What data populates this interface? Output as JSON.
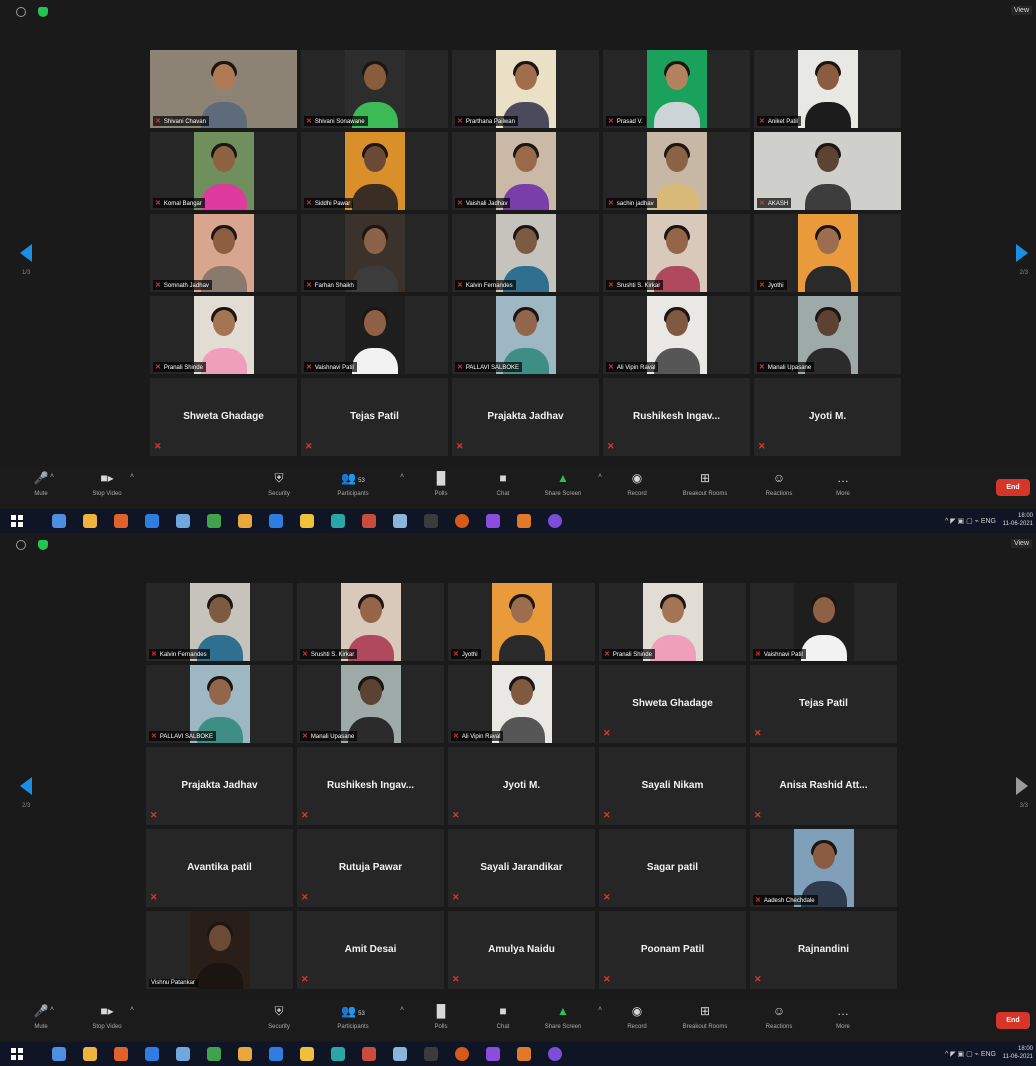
{
  "screenshots": [
    {
      "top_bar": {
        "view_label": "View"
      },
      "nav": {
        "left_page": "1/3",
        "right_page": "2/3"
      },
      "participants": [
        {
          "name": "Shivani Chavan",
          "video": true,
          "wide": true,
          "skin": "#b07a56",
          "shirt": "#5e6b7a",
          "bg": "#8d8374"
        },
        {
          "name": "Shivani Sonawane",
          "video": true,
          "skin": "#8a5c3e",
          "shirt": "#3cba55",
          "bg": "#2d2d2d"
        },
        {
          "name": "Prarthana Pailwan",
          "video": true,
          "skin": "#a26d4c",
          "shirt": "#4a4a5c",
          "bg": "#e9e0c6"
        },
        {
          "name": "Prasad V.",
          "video": true,
          "skin": "#b3835f",
          "shirt": "#cdd4d8",
          "bg": "#1aa25d"
        },
        {
          "name": "Aniket Patil",
          "video": true,
          "skin": "#8b5d40",
          "shirt": "#1c1c1c",
          "bg": "#e8e8e4"
        },
        {
          "name": "Komal Bangar",
          "video": true,
          "skin": "#8f6244",
          "shirt": "#de3aa0",
          "bg": "#6f8f5c"
        },
        {
          "name": "Siddhi Pawar",
          "video": true,
          "skin": "#6a4a35",
          "shirt": "#3a2d24",
          "bg": "#d9902a"
        },
        {
          "name": "Vaishali Jadhav",
          "video": true,
          "skin": "#9a6a4b",
          "shirt": "#7a3ea8",
          "bg": "#c9b9a6"
        },
        {
          "name": "sachin jadhav",
          "video": true,
          "skin": "#8b6345",
          "shirt": "#d8b978",
          "bg": "#c7b8a6"
        },
        {
          "name": "AKASH",
          "video": true,
          "wide": true,
          "skin": "#5b4434",
          "shirt": "#3d3d3d",
          "bg": "#cfcfcc"
        },
        {
          "name": "Somnath Jadhav",
          "video": true,
          "skin": "#8d5e42",
          "shirt": "#8a7a6e",
          "bg": "#d8a58e"
        },
        {
          "name": "Farhan Shaikh",
          "video": true,
          "skin": "#8a6349",
          "shirt": "#3c3c3c",
          "bg": "#3b322b"
        },
        {
          "name": "Kalvin Fernandes",
          "video": true,
          "skin": "#7d5a42",
          "shirt": "#2f6f8f",
          "bg": "#c6c3bd"
        },
        {
          "name": "Srushti S. Kirkar",
          "video": true,
          "skin": "#946548",
          "shirt": "#b0485e",
          "bg": "#d9c9bb"
        },
        {
          "name": "Jyothi",
          "video": true,
          "skin": "#9c6d4e",
          "shirt": "#2a2a2a",
          "bg": "#e99a3a"
        },
        {
          "name": "Pranali Shinde",
          "video": true,
          "skin": "#a47552",
          "shirt": "#ef9fb9",
          "bg": "#e1dcd4"
        },
        {
          "name": "Vaishnavi Patil",
          "video": true,
          "skin": "#8e6147",
          "shirt": "#f2f2f2",
          "bg": "#1e1e1e"
        },
        {
          "name": "PALLAVI SALBOKE",
          "video": true,
          "skin": "#91664b",
          "shirt": "#3e8e85",
          "bg": "#9db8c3"
        },
        {
          "name": "Ali Vipin Raval",
          "video": true,
          "skin": "#7f5a40",
          "shirt": "#565656",
          "bg": "#e9e8e5"
        },
        {
          "name": "Manali Upasane",
          "video": true,
          "skin": "#5c4232",
          "shirt": "#2b2b2b",
          "bg": "#9eaaa8"
        },
        {
          "name": "Shweta Ghadage",
          "video": false
        },
        {
          "name": "Tejas Patil",
          "video": false
        },
        {
          "name": "Prajakta Jadhav",
          "video": false
        },
        {
          "name": "Rushikesh  Ingav...",
          "video": false
        },
        {
          "name": "Jyoti M.",
          "video": false
        }
      ],
      "toolbar": {
        "mute": "Mute",
        "stop_video": "Stop Video",
        "security": "Security",
        "participants": "Participants",
        "participants_count": "53",
        "polls": "Polls",
        "chat": "Chat",
        "share_screen": "Share Screen",
        "record": "Record",
        "breakout_rooms": "Breakout Rooms",
        "reactions": "Reactions",
        "more": "More",
        "end": "End"
      },
      "taskbar": {
        "tray": "^ ◤ ▣ ▢ ⌁ ENG",
        "time": "18:00",
        "date": "11-06-2021"
      }
    },
    {
      "top_bar": {
        "view_label": "View"
      },
      "nav": {
        "left_page": "2/3",
        "right_page": "3/3"
      },
      "participants": [
        {
          "name": "Kalvin Fernandes",
          "video": true,
          "skin": "#7d5a42",
          "shirt": "#2f6f8f",
          "bg": "#c6c3bd"
        },
        {
          "name": "Srushti S. Kirkar",
          "video": true,
          "skin": "#946548",
          "shirt": "#b0485e",
          "bg": "#d9c9bb"
        },
        {
          "name": "Jyothi",
          "video": true,
          "skin": "#9c6d4e",
          "shirt": "#2a2a2a",
          "bg": "#e99a3a"
        },
        {
          "name": "Pranali Shinde",
          "video": true,
          "skin": "#a47552",
          "shirt": "#ef9fb9",
          "bg": "#e1dcd4"
        },
        {
          "name": "Vaishnavi Patil",
          "video": true,
          "skin": "#8e6147",
          "shirt": "#f2f2f2",
          "bg": "#1e1e1e"
        },
        {
          "name": "PALLAVI SALBOKE",
          "video": true,
          "skin": "#91664b",
          "shirt": "#3e8e85",
          "bg": "#9db8c3"
        },
        {
          "name": "Manali Upasane",
          "video": true,
          "skin": "#5c4232",
          "shirt": "#2b2b2b",
          "bg": "#9eaaa8"
        },
        {
          "name": "Ali Vipin Raval",
          "video": true,
          "skin": "#7f5a40",
          "shirt": "#565656",
          "bg": "#e9e8e5"
        },
        {
          "name": "Shweta Ghadage",
          "video": false
        },
        {
          "name": "Tejas Patil",
          "video": false
        },
        {
          "name": "Prajakta Jadhav",
          "video": false
        },
        {
          "name": "Rushikesh  Ingav...",
          "video": false
        },
        {
          "name": "Jyoti M.",
          "video": false
        },
        {
          "name": "Sayali Nikam",
          "video": false
        },
        {
          "name": "Anisa Rashid Att...",
          "video": false
        },
        {
          "name": "Avantika patil",
          "video": false
        },
        {
          "name": "Rutuja Pawar",
          "video": false
        },
        {
          "name": "Sayali Jarandikar",
          "video": false
        },
        {
          "name": "Sagar patil",
          "video": false
        },
        {
          "name": "Aadesh Chechdale",
          "video": true,
          "skin": "#8a5d42",
          "shirt": "#2f3b4a",
          "bg": "#7fa0b8"
        },
        {
          "name": "Vishnu Patankar",
          "video": true,
          "skin": "#6b4a36",
          "shirt": "#1c1410",
          "bg": "#2a1f18",
          "no_mic": true
        },
        {
          "name": "Amit Desai",
          "video": false
        },
        {
          "name": "Amulya Naidu",
          "video": false
        },
        {
          "name": "Poonam Patil",
          "video": false
        },
        {
          "name": "Rajnandini",
          "video": false
        }
      ],
      "toolbar": {
        "mute": "Mute",
        "stop_video": "Stop Video",
        "security": "Security",
        "participants": "Participants",
        "participants_count": "53",
        "polls": "Polls",
        "chat": "Chat",
        "share_screen": "Share Screen",
        "record": "Record",
        "breakout_rooms": "Breakout Rooms",
        "reactions": "Reactions",
        "more": "More",
        "end": "End"
      },
      "taskbar": {
        "tray": "^ ◤ ▣ ▢ ⌁ ENG",
        "time": "18:00",
        "date": "11-06-2021"
      }
    }
  ],
  "colors": {
    "accent": "#1a8fe3",
    "end_red": "#d8352a",
    "muted_red": "#e5342c",
    "share_green": "#23c552"
  }
}
